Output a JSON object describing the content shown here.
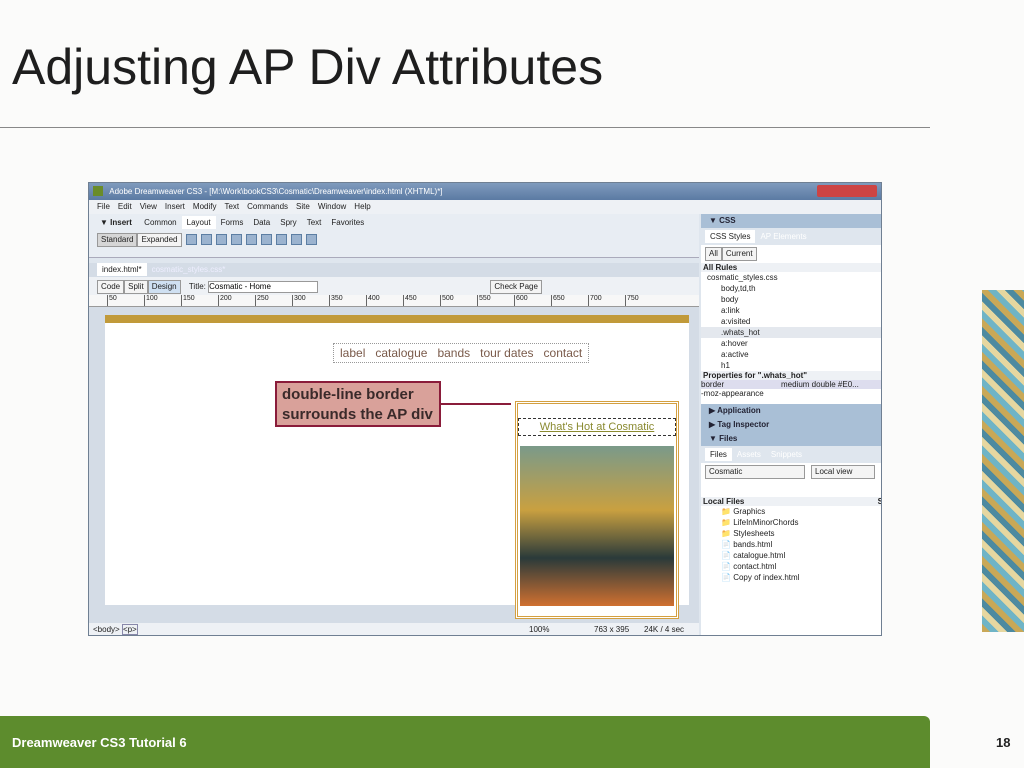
{
  "slide": {
    "title": "Adjusting AP Div Attributes",
    "footer": "Dreamweaver CS3 Tutorial 6",
    "page_number": "18"
  },
  "window": {
    "title": "Adobe Dreamweaver CS3 - [M:\\Work\\bookCS3\\Cosmatic\\Dreamweaver\\index.html (XHTML)*]",
    "menu": [
      "File",
      "Edit",
      "View",
      "Insert",
      "Modify",
      "Text",
      "Commands",
      "Site",
      "Window",
      "Help"
    ],
    "insert_label": "▼ Insert",
    "insert_tabs": [
      "Common",
      "Layout",
      "Forms",
      "Data",
      "Spry",
      "Text",
      "Favorites"
    ],
    "mode_buttons": [
      "Standard",
      "Expanded"
    ],
    "doc_tabs": [
      "index.html*",
      "cosmatic_styles.css*"
    ],
    "view_buttons": [
      "Code",
      "Split",
      "Design"
    ],
    "title_label": "Title:",
    "title_value": "Cosmatic - Home",
    "check_page": "Check Page",
    "ruler": [
      "50",
      "100",
      "150",
      "200",
      "250",
      "300",
      "350",
      "400",
      "450",
      "500",
      "550",
      "600",
      "650",
      "700",
      "750"
    ],
    "nav_links": [
      "label",
      "catalogue",
      "bands",
      "tour dates",
      "contact"
    ],
    "callout": "double-line border surrounds the AP div",
    "whats_hot": "What's Hot at Cosmatic",
    "status": {
      "tags": [
        "<body>",
        "<p>"
      ],
      "zoom": "100%",
      "size": "763 x 395",
      "download": "24K / 4 sec"
    }
  },
  "css_panel": {
    "header": "▼ CSS",
    "tabs": [
      "CSS Styles",
      "AP Elements"
    ],
    "buttons": [
      "All",
      "Current"
    ],
    "all_rules": "All Rules",
    "file": "cosmatic_styles.css",
    "rules": [
      "body,td,th",
      "body",
      "a:link",
      "a:visited",
      ".whats_hot",
      "a:hover",
      "a:active",
      "h1"
    ],
    "props_title": "Properties for \".whats_hot\"",
    "props": [
      {
        "name": "border",
        "value": "medium double #E0..."
      },
      {
        "name": "-moz-appearance",
        "value": ""
      }
    ]
  },
  "collapsed_panels": [
    "▶ Application",
    "▶ Tag Inspector"
  ],
  "files_panel": {
    "header": "▼ Files",
    "tabs": [
      "Files",
      "Assets",
      "Snippets"
    ],
    "site": "Cosmatic",
    "view": "Local view",
    "local_files": "Local Files",
    "col": "S",
    "items": [
      {
        "name": "Graphics",
        "folder": true
      },
      {
        "name": "LifeInMinorChords",
        "folder": true
      },
      {
        "name": "Stylesheets",
        "folder": true
      },
      {
        "name": "bands.html",
        "folder": false
      },
      {
        "name": "catalogue.html",
        "folder": false
      },
      {
        "name": "contact.html",
        "folder": false
      },
      {
        "name": "Copy of index.html",
        "folder": false
      }
    ]
  }
}
